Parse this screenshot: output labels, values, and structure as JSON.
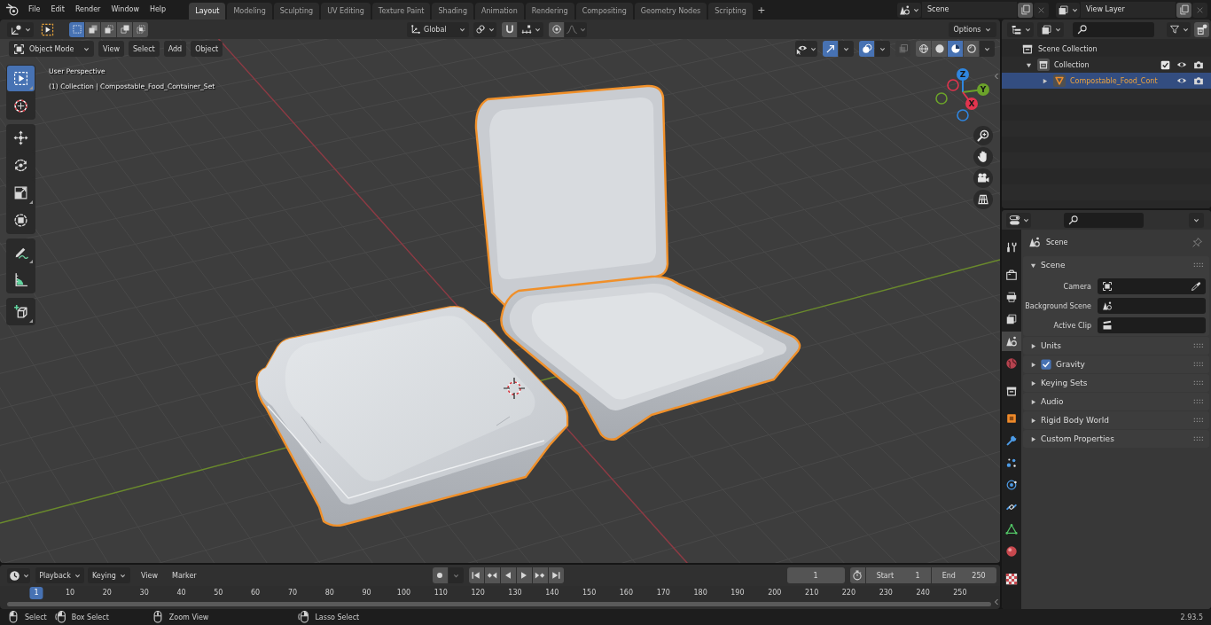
{
  "top_bar": {
    "menus": [
      "File",
      "Edit",
      "Render",
      "Window",
      "Help"
    ],
    "workspaces": [
      {
        "label": "Layout",
        "selected": true
      },
      {
        "label": "Modeling",
        "selected": false
      },
      {
        "label": "Sculpting",
        "selected": false
      },
      {
        "label": "UV Editing",
        "selected": false
      },
      {
        "label": "Texture Paint",
        "selected": false
      },
      {
        "label": "Shading",
        "selected": false
      },
      {
        "label": "Animation",
        "selected": false
      },
      {
        "label": "Rendering",
        "selected": false
      },
      {
        "label": "Compositing",
        "selected": false
      },
      {
        "label": "Geometry Nodes",
        "selected": false
      },
      {
        "label": "Scripting",
        "selected": false
      }
    ],
    "add_tab": "+",
    "scene": "Scene",
    "view_layer": "View Layer"
  },
  "viewport": {
    "select_modes": [
      {
        "kind": "set",
        "selected": true
      },
      {
        "kind": "extend",
        "selected": false
      },
      {
        "kind": "subtract",
        "selected": false
      },
      {
        "kind": "invert",
        "selected": false
      },
      {
        "kind": "intersect",
        "selected": false
      }
    ],
    "orientation": "Global",
    "options": "Options",
    "mode": "Object Mode",
    "menus": [
      "View",
      "Select",
      "Add",
      "Object"
    ],
    "gizmos_on": true,
    "overlays_on": true,
    "xray_on": false,
    "shading": [
      {
        "kind": "wireframe",
        "selected": false
      },
      {
        "kind": "solid",
        "selected": false
      },
      {
        "kind": "material",
        "selected": true
      },
      {
        "kind": "rendered",
        "selected": false
      }
    ],
    "info": [
      "User Perspective",
      "(1) Collection | Compostable_Food_Container_Set"
    ],
    "tool_groups": [
      [
        {
          "kind": "select-box",
          "selected": true,
          "more_tools": true
        },
        {
          "kind": "cursor",
          "selected": false,
          "more_tools": false
        }
      ],
      [
        {
          "kind": "move",
          "selected": false,
          "more_tools": false
        },
        {
          "kind": "rotate",
          "selected": false,
          "more_tools": false
        },
        {
          "kind": "scale",
          "selected": false,
          "more_tools": true
        },
        {
          "kind": "transform",
          "selected": false,
          "more_tools": false
        }
      ],
      [
        {
          "kind": "annotate",
          "selected": false,
          "more_tools": true
        },
        {
          "kind": "measure",
          "selected": false,
          "more_tools": false
        }
      ],
      [
        {
          "kind": "add-cube",
          "selected": false,
          "more_tools": true
        }
      ]
    ],
    "nav_axes": [
      {
        "label": "Z",
        "color": "#2f86e0"
      },
      {
        "label": "Y",
        "color": "#6ba22a"
      },
      {
        "label": "X",
        "color": "#e2344e"
      }
    ]
  },
  "timeline": {
    "menus": [
      {
        "label": "Playback",
        "kind": "dropdown"
      },
      {
        "label": "Keying",
        "kind": "dropdown"
      },
      {
        "label": "View",
        "kind": "menu"
      },
      {
        "label": "Marker",
        "kind": "menu"
      }
    ],
    "current_frame": "1",
    "start_label": "Start",
    "start": "1",
    "end_label": "End",
    "end": "250",
    "frames": [
      {
        "label": "1",
        "selected": true
      },
      {
        "label": "10",
        "selected": false
      },
      {
        "label": "20",
        "selected": false
      },
      {
        "label": "30",
        "selected": false
      },
      {
        "label": "40",
        "selected": false
      },
      {
        "label": "50",
        "selected": false
      },
      {
        "label": "60",
        "selected": false
      },
      {
        "label": "70",
        "selected": false
      },
      {
        "label": "80",
        "selected": false
      },
      {
        "label": "90",
        "selected": false
      },
      {
        "label": "100",
        "selected": false
      },
      {
        "label": "110",
        "selected": false
      },
      {
        "label": "120",
        "selected": false
      },
      {
        "label": "130",
        "selected": false
      },
      {
        "label": "140",
        "selected": false
      },
      {
        "label": "150",
        "selected": false
      },
      {
        "label": "160",
        "selected": false
      },
      {
        "label": "170",
        "selected": false
      },
      {
        "label": "180",
        "selected": false
      },
      {
        "label": "190",
        "selected": false
      },
      {
        "label": "200",
        "selected": false
      },
      {
        "label": "210",
        "selected": false
      },
      {
        "label": "220",
        "selected": false
      },
      {
        "label": "230",
        "selected": false
      },
      {
        "label": "240",
        "selected": false
      },
      {
        "label": "250",
        "selected": false
      }
    ]
  },
  "outliner": {
    "rows": [
      {
        "label": "Scene Collection",
        "kind": "scene-collection",
        "selected": false,
        "children": [
          {
            "label": "Collection",
            "kind": "collection",
            "selected": false,
            "expanded": true,
            "checked": true,
            "children": [
              {
                "label": "Compostable_Food_Cont",
                "kind": "mesh-object",
                "selected": true,
                "expanded": false
              }
            ]
          }
        ]
      }
    ]
  },
  "properties": {
    "tabs": [
      {
        "kind": "tool",
        "selected": false
      },
      {
        "kind": "render",
        "selected": false
      },
      {
        "kind": "output",
        "selected": false
      },
      {
        "kind": "view-layer",
        "selected": false
      },
      {
        "kind": "scene",
        "selected": true
      },
      {
        "kind": "world",
        "selected": false
      },
      {
        "kind": "collection",
        "selected": false
      },
      {
        "kind": "object",
        "selected": false
      },
      {
        "kind": "modifiers",
        "selected": false
      },
      {
        "kind": "particles",
        "selected": false
      },
      {
        "kind": "physics",
        "selected": false
      },
      {
        "kind": "constraints",
        "selected": false
      },
      {
        "kind": "data",
        "selected": false
      },
      {
        "kind": "material",
        "selected": false
      },
      {
        "kind": "texture",
        "selected": false
      }
    ],
    "context": "Scene",
    "panels": [
      {
        "label": "Scene",
        "kind": "plain",
        "expanded": true,
        "fields": [
          {
            "label": "Camera",
            "kind": "camera"
          },
          {
            "label": "Background Scene",
            "kind": "scene"
          },
          {
            "label": "Active Clip",
            "kind": "clip"
          }
        ]
      },
      {
        "label": "Units",
        "kind": "plain",
        "expanded": false
      },
      {
        "label": "Gravity",
        "kind": "toggle",
        "expanded": false,
        "checked": true
      },
      {
        "label": "Keying Sets",
        "kind": "plain",
        "expanded": false
      },
      {
        "label": "Audio",
        "kind": "plain",
        "expanded": false
      },
      {
        "label": "Rigid Body World",
        "kind": "plain",
        "expanded": false
      },
      {
        "label": "Custom Properties",
        "kind": "plain",
        "expanded": false
      }
    ]
  },
  "status_bar": {
    "hints": [
      {
        "kind": "mouse-left",
        "label": "Select"
      },
      {
        "kind": "mouse-left-drag",
        "label": "Box Select"
      },
      {
        "kind": "mouse-middle",
        "label": "Zoom View"
      },
      {
        "kind": "mouse-right-drag",
        "label": "Lasso Select"
      }
    ],
    "version": "2.93.5"
  }
}
